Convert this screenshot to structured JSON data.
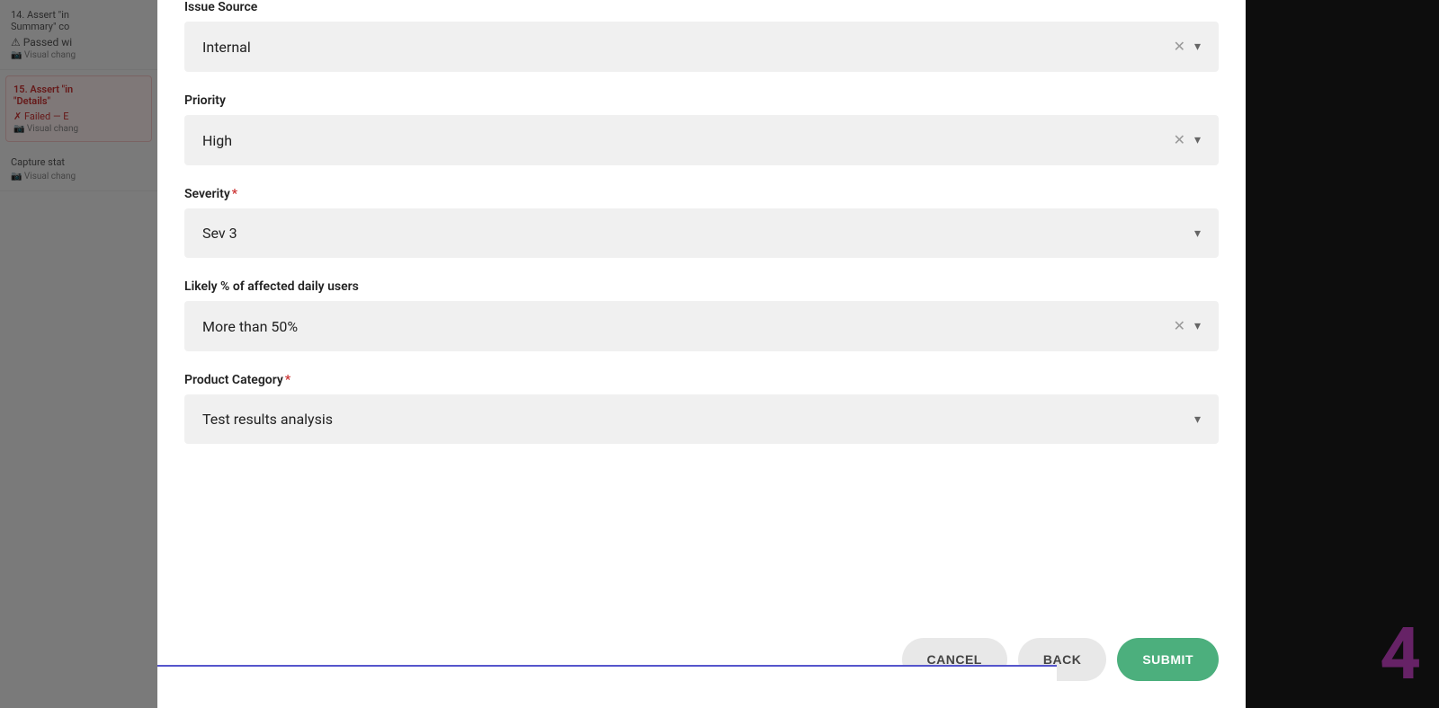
{
  "sidebar": {
    "items": [
      {
        "id": "item-14",
        "title": "14. Assert \"in Summary\" co",
        "status_type": "passed",
        "status": "Passed wi",
        "visual": "Visual chang"
      },
      {
        "id": "item-15",
        "title": "15. Assert \"in \"Details\"",
        "status_type": "failed",
        "status": "Failed — E",
        "visual": "Visual chang"
      },
      {
        "id": "item-capture",
        "title": "Capture stat",
        "status_type": "capture",
        "visual": "Visual chang"
      }
    ]
  },
  "modal": {
    "fields": [
      {
        "id": "issue-source",
        "label": "Issue Source",
        "required": false,
        "value": "Internal",
        "has_clear": true,
        "has_chevron": true
      },
      {
        "id": "priority",
        "label": "Priority",
        "required": false,
        "value": "High",
        "has_clear": true,
        "has_chevron": true
      },
      {
        "id": "severity",
        "label": "Severity",
        "required": true,
        "value": "Sev 3",
        "has_clear": false,
        "has_chevron": true
      },
      {
        "id": "affected-users",
        "label": "Likely % of affected daily users",
        "required": false,
        "value": "More than 50%",
        "has_clear": true,
        "has_chevron": true
      },
      {
        "id": "product-category",
        "label": "Product Category",
        "required": true,
        "value": "Test results analysis",
        "has_clear": false,
        "has_chevron": true
      }
    ],
    "footer": {
      "cancel_label": "CANCEL",
      "back_label": "BACK",
      "submit_label": "SUBMIT"
    }
  },
  "step_number": "4",
  "icons": {
    "warning": "⚠",
    "camera": "📷",
    "cross": "✕",
    "chevron_down": "▾",
    "x_mark": "✗"
  }
}
